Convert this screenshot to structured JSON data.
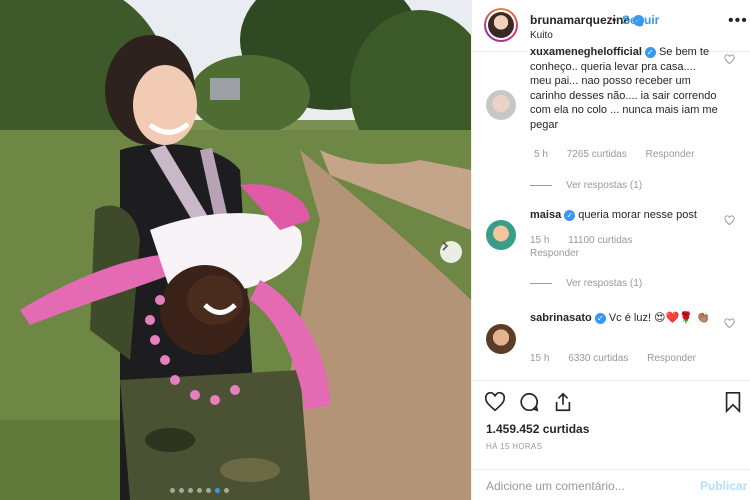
{
  "post": {
    "username": "brunamarquezine",
    "location": "Kuito",
    "follow_label": "Seguir",
    "separator": "•",
    "more_icon": "more-horizontal-icon",
    "photo_alt": "photo",
    "carousel": {
      "dots": 7,
      "active_index": 5
    }
  },
  "comments": [
    {
      "username": "xuxameneghelofficial",
      "text": "Se bem te conheço.. queria levar pra casa.... meu pai... nao posso receber um carinho desses não.... ia sair correndo com ela no colo ... nunca mais iam me pegar",
      "time": "5 h",
      "likes": "7265 curtidas",
      "reply_label": "Responder",
      "see_replies": "Ver respostas (1)"
    },
    {
      "username": "maisa",
      "text": "queria morar nesse post",
      "time": "15 h",
      "likes": "11100 curtidas",
      "reply_label": "Responder",
      "see_replies": "Ver respostas (1)"
    },
    {
      "username": "sabrinasato",
      "text": "Vc é luz! 😍❤️🌹 👏🏽",
      "time": "15 h",
      "likes": "6330 curtidas",
      "reply_label": "Responder"
    }
  ],
  "footer": {
    "likes_count": "1.459.452 curtidas",
    "timestamp": "HÁ 15 HORAS",
    "comment_placeholder": "Adicione um comentário...",
    "publish_label": "Publicar"
  },
  "colors": {
    "accent": "#3897f0",
    "muted": "#999999",
    "text": "#262626",
    "publish_disabled": "#b2dffc"
  }
}
